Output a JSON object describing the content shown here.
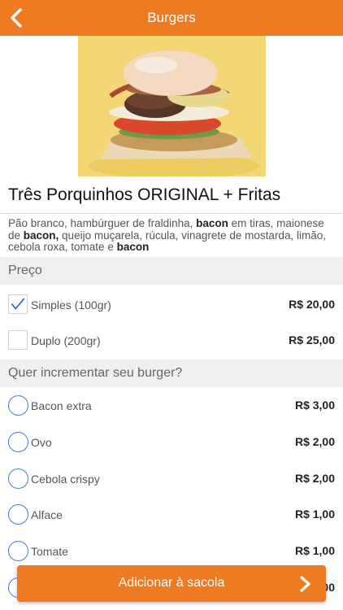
{
  "header": {
    "title": "Burgers",
    "back_icon": "chevron-left-icon"
  },
  "product": {
    "name": "Três Porquinhos ORIGINAL + Fritas",
    "description_parts": [
      {
        "text": "Pão branco, hambúrguer de fraldinha, ",
        "bold": false
      },
      {
        "text": "bacon",
        "bold": true
      },
      {
        "text": " em tiras, maionese de ",
        "bold": false
      },
      {
        "text": "bacon,",
        "bold": true
      },
      {
        "text": " queijo muçarela, rúcula, vinagrete de mostarda, limão, cebola roxa, tomate e ",
        "bold": false
      },
      {
        "text": "bacon",
        "bold": true
      }
    ]
  },
  "price_section": {
    "title": "Preço",
    "options": [
      {
        "label": "Simples (100gr)",
        "price": "R$ 20,00",
        "checked": true
      },
      {
        "label": "Duplo (200gr)",
        "price": "R$ 25,00",
        "checked": false
      }
    ]
  },
  "extras_section": {
    "title": "Quer incrementar seu burger?",
    "options": [
      {
        "label": "Bacon extra",
        "price": "R$ 3,00"
      },
      {
        "label": "Ovo",
        "price": "R$ 2,00"
      },
      {
        "label": "Cebola crispy",
        "price": "R$ 2,00"
      },
      {
        "label": "Alface",
        "price": "R$ 1,00"
      },
      {
        "label": "Tomate",
        "price": "R$ 1,00"
      }
    ],
    "partial_price": "00"
  },
  "cta": {
    "label": "Adicionar à sacola",
    "icon": "chevron-right-icon"
  },
  "colors": {
    "accent": "#ee7a22",
    "radio": "#4a7bd4",
    "section_bg": "#efefef"
  }
}
